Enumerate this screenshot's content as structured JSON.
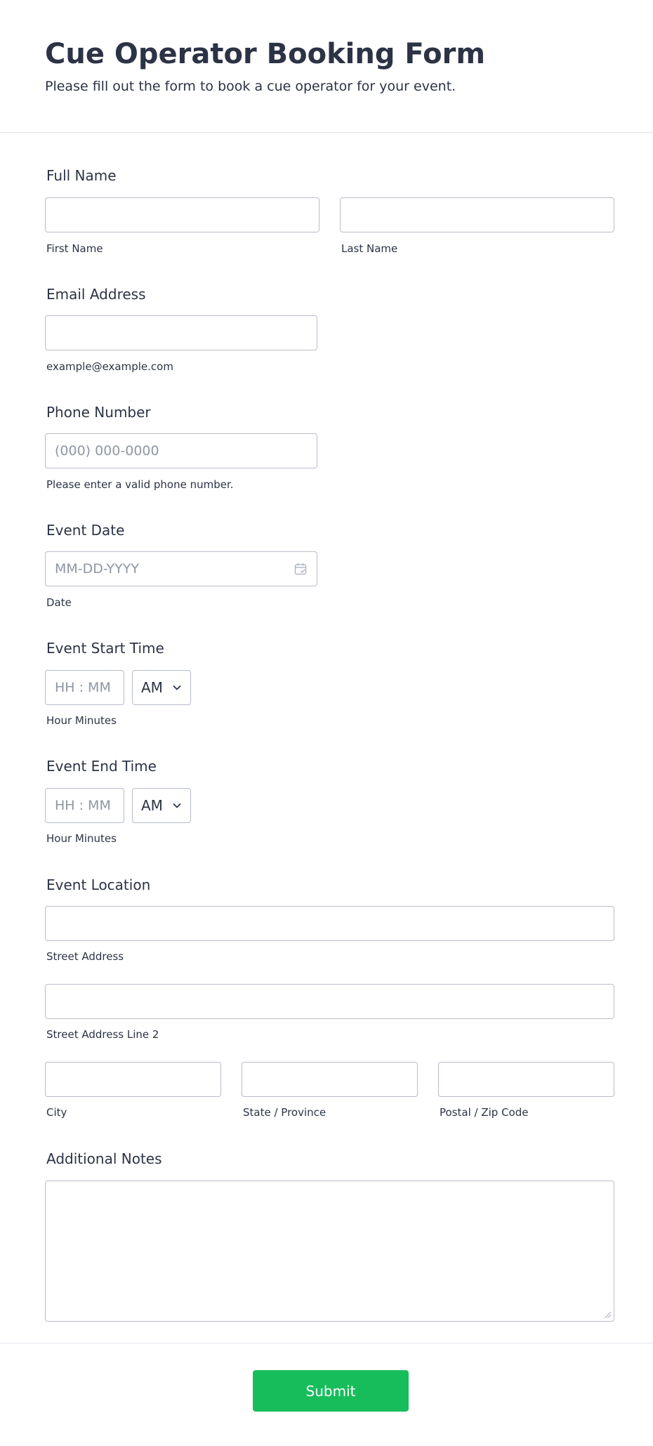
{
  "form": {
    "title": "Cue Operator Booking Form",
    "subtitle": "Please fill out the form to book a cue operator for your event."
  },
  "full_name": {
    "label": "Full Name",
    "first_sublabel": "First Name",
    "last_sublabel": "Last Name",
    "first_value": "",
    "last_value": ""
  },
  "email": {
    "label": "Email Address",
    "sublabel": "example@example.com",
    "value": ""
  },
  "phone": {
    "label": "Phone Number",
    "placeholder": "(000) 000-0000",
    "sublabel": "Please enter a valid phone number."
  },
  "event_date": {
    "label": "Event Date",
    "placeholder": "MM-DD-YYYY",
    "sublabel": "Date",
    "icon": "calendar-icon"
  },
  "start_time": {
    "label": "Event Start Time",
    "placeholder": "HH : MM",
    "period": "AM",
    "sublabel": "Hour Minutes"
  },
  "end_time": {
    "label": "Event End Time",
    "placeholder": "HH : MM",
    "period": "AM",
    "sublabel": "Hour Minutes"
  },
  "location": {
    "label": "Event Location",
    "street_sublabel": "Street Address",
    "street2_sublabel": "Street Address Line 2",
    "city_sublabel": "City",
    "state_sublabel": "State / Province",
    "zip_sublabel": "Postal / Zip Code"
  },
  "notes": {
    "label": "Additional Notes",
    "value": ""
  },
  "submit": {
    "label": "Submit"
  },
  "colors": {
    "text": "#2c3345",
    "border": "#b8bdc9",
    "placeholder": "#8f96a3",
    "divider": "#e3e5eb",
    "submit_bg": "#18bd5b",
    "submit_text": "#ffffff"
  }
}
